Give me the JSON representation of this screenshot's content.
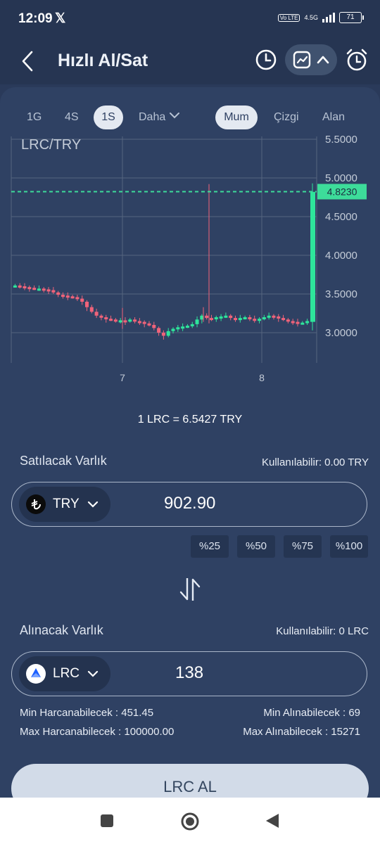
{
  "status": {
    "time": "12:09",
    "x_icon": "x-icon",
    "volte": "Vo LTE",
    "network": "4.5G",
    "battery": "71"
  },
  "header": {
    "title": "Hızlı Al/Sat"
  },
  "timeframes": [
    "1G",
    "4S",
    "1S",
    "Daha"
  ],
  "selected_timeframe": "1S",
  "chart_modes": [
    "Mum",
    "Çizgi",
    "Alan"
  ],
  "selected_mode": "Mum",
  "chart_data": {
    "type": "candlestick",
    "title": "LRC/TRY",
    "y_ticks": [
      "5.5000",
      "5.0000",
      "4.5000",
      "4.0000",
      "3.5000",
      "3.0000"
    ],
    "x_ticks": [
      "7",
      "8"
    ],
    "ylim": [
      2.6,
      5.6
    ],
    "last_price": 4.823,
    "last_price_label": "4.8230",
    "colors": {
      "up": "#2ee59b",
      "down": "#f0637a",
      "grid": "#55657f",
      "last": "#3ddc9a"
    }
  },
  "rate": "1 LRC = 6.5427 TRY",
  "sell": {
    "label": "Satılacak Varlık",
    "available": "Kullanılabilir: 0.00 TRY",
    "asset": "TRY",
    "amount": "902.90",
    "percents": [
      "%25",
      "%50",
      "%75",
      "%100"
    ]
  },
  "buy": {
    "label": "Alınacak Varlık",
    "available": "Kullanılabilir: 0 LRC",
    "asset": "LRC",
    "amount": "138"
  },
  "limits": {
    "min_spend": "Min Harcanabilecek : 451.45",
    "min_receive": "Min Alınabilecek : 69",
    "max_spend": "Max Harcanabilecek : 100000.00",
    "max_receive": "Max Alınabilecek : 15271"
  },
  "cta_label": "LRC AL"
}
